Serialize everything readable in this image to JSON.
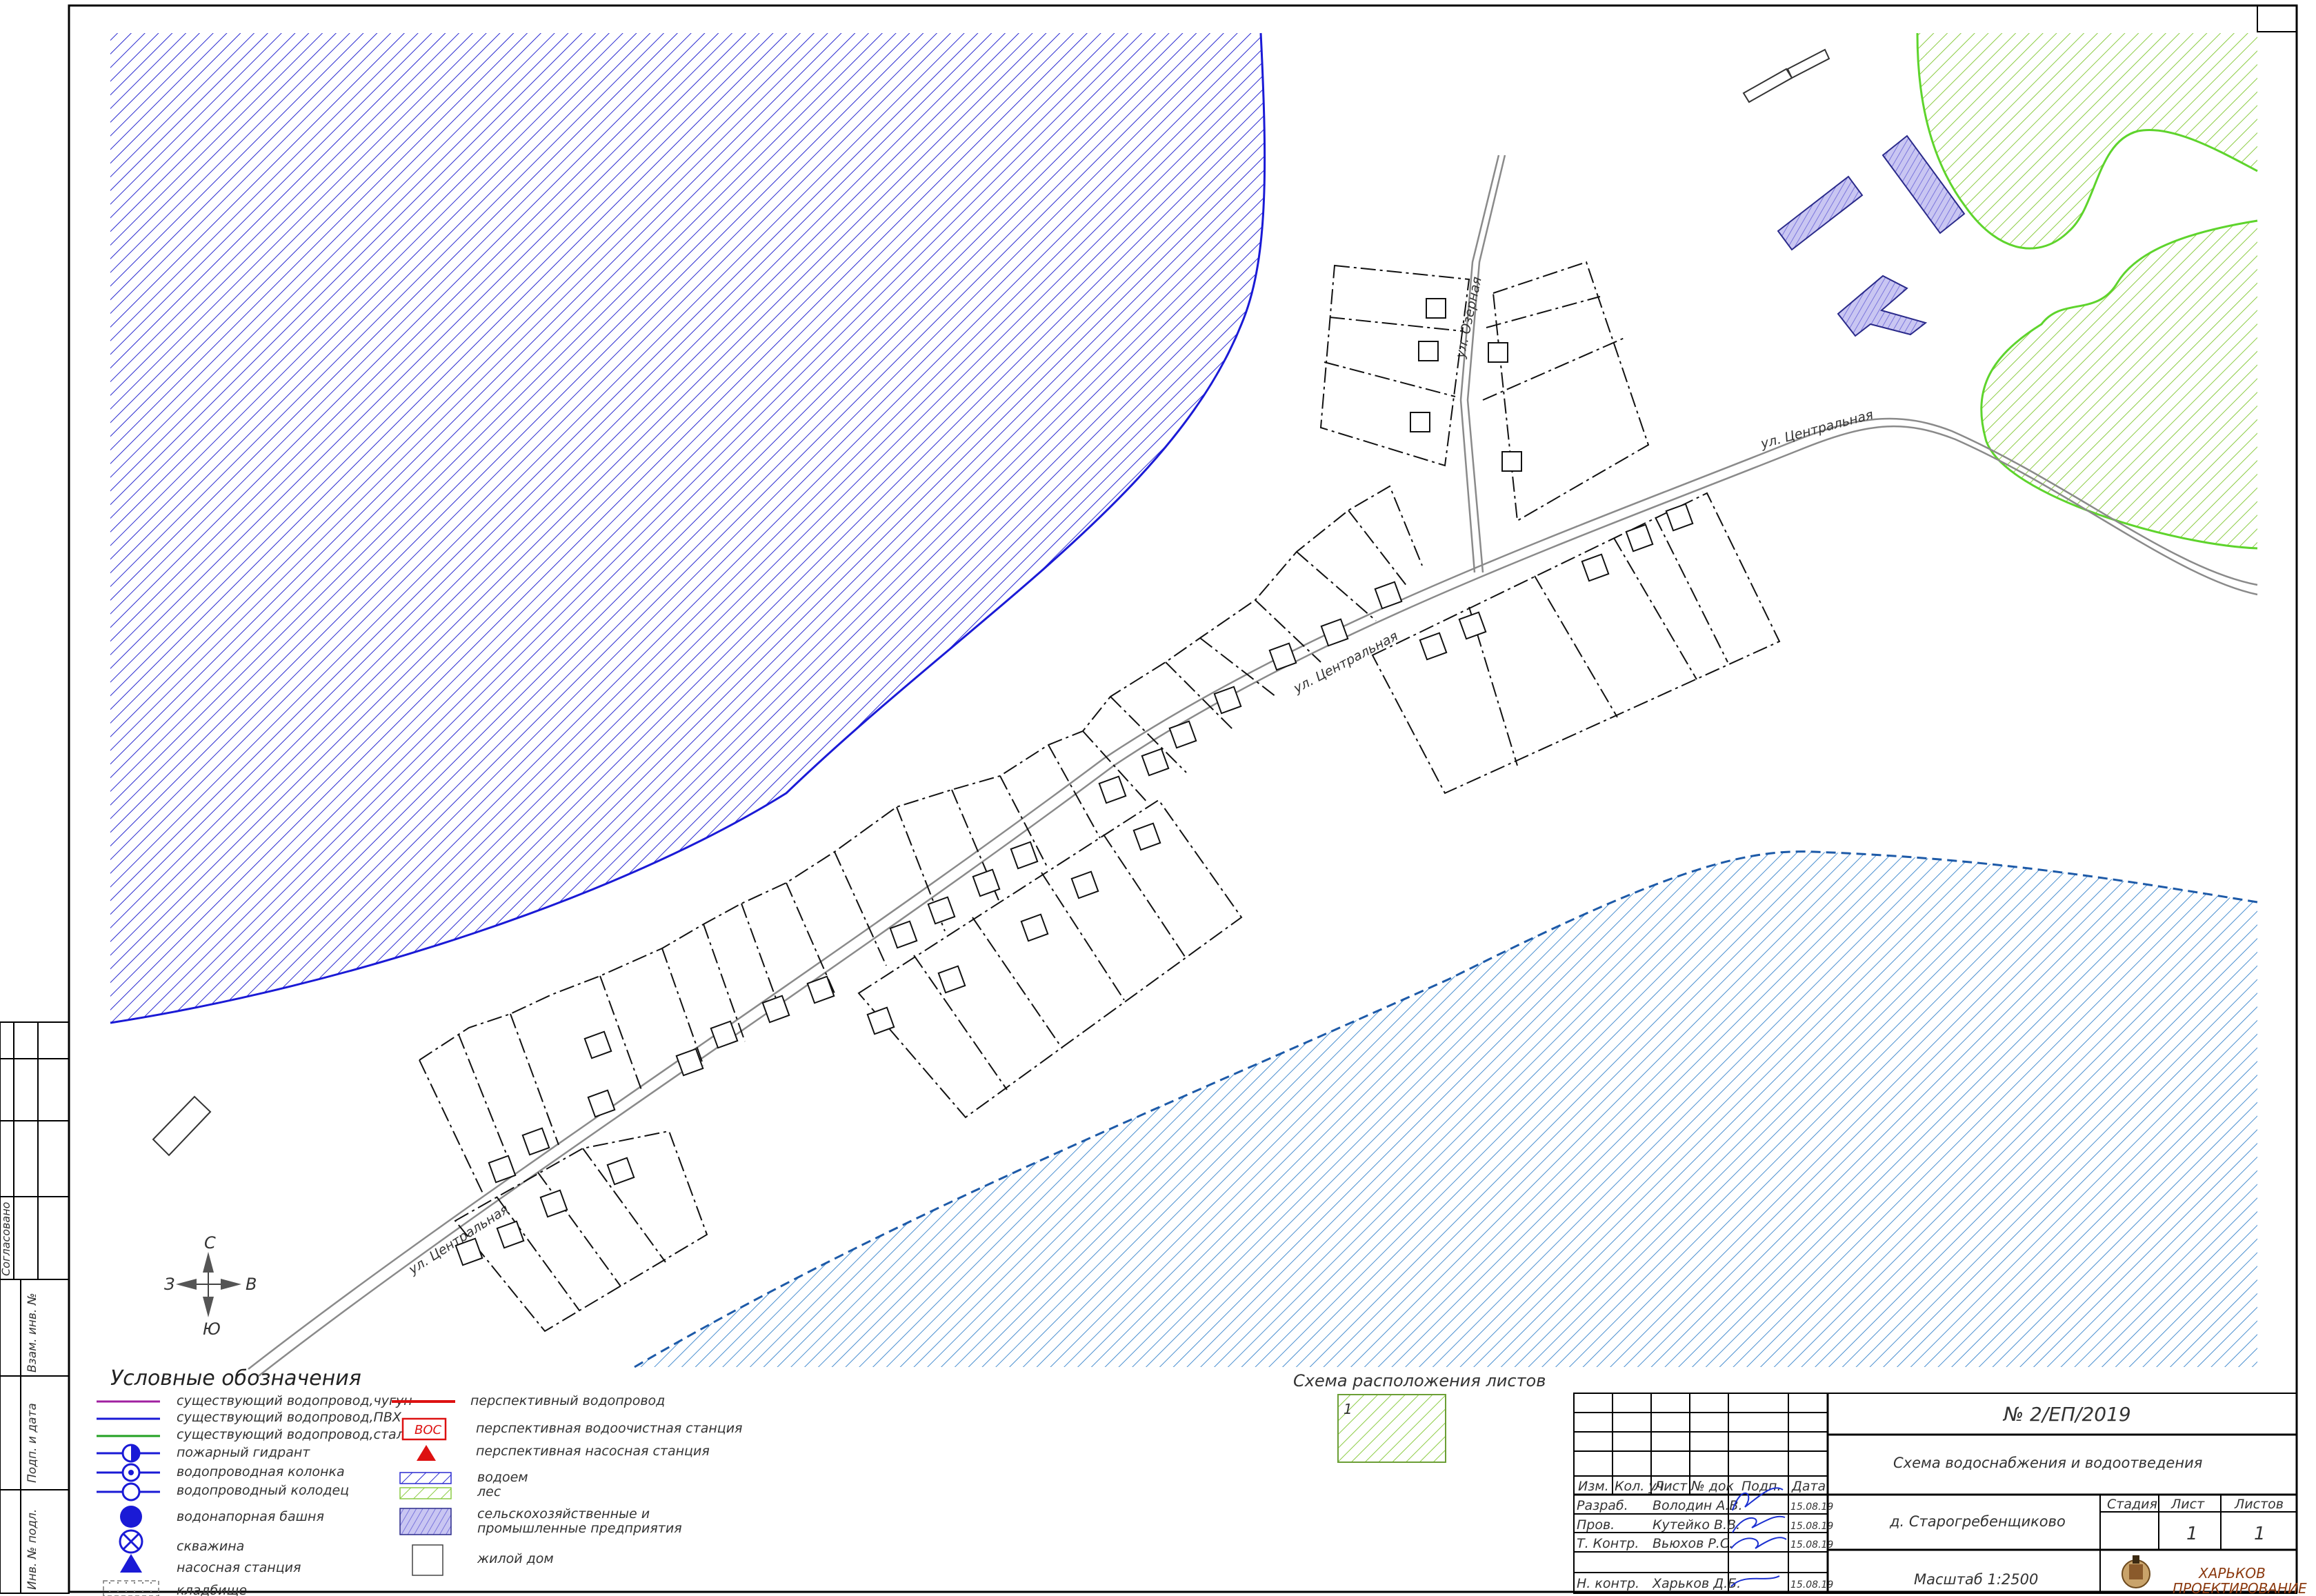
{
  "map": {
    "streets": {
      "central_1": "ул. Центральная",
      "central_2": "ул. Центральная",
      "central_3": "ул. Центральная",
      "lake": "ул. Озёрная"
    },
    "compass": {
      "north": "С",
      "south": "Ю",
      "west": "З",
      "east": "В"
    }
  },
  "legend": {
    "title": "Условные обозначения",
    "items": [
      "существующий водопровод,чугун",
      "существующий водопровод,ПВХ",
      "существующий водопровод,сталь",
      "пожарный гидрант",
      "водопроводная колонка",
      "водопроводный колодец",
      "водонапорная башня",
      "скважина",
      "насосная станция",
      "кладбище"
    ],
    "items_right": [
      "перспективный водопровод",
      "перспективная водоочистная станция",
      "перспективная насосная станция",
      "водоем",
      "лес",
      "сельскохозяйственные и",
      "промышленные предприятия",
      "жилой дом"
    ],
    "voc_label": "ВОС"
  },
  "sheet_scheme": {
    "title": "Схема расположения листов",
    "sheet_no": "1"
  },
  "title_block": {
    "doc_number": "№ 2/ЕП/2019",
    "project_title": "Схема водоснабжения и водоотведения",
    "location": "д. Старогребенщиково",
    "scale": "Масштаб 1:2500",
    "col_headers": [
      "Изм.",
      "Кол. уч",
      "Лист",
      "№ док",
      "Подп.",
      "Дата"
    ],
    "stage_headers": [
      "Стадия",
      "Лист",
      "Листов"
    ],
    "sheet": "1",
    "sheets": "1",
    "rows": [
      {
        "role": "Разраб.",
        "name": "Володин А.В.",
        "date": "15.08.19"
      },
      {
        "role": "Пров.",
        "name": "Кутейко В.В.",
        "date": "15.08.19"
      },
      {
        "role": "Т. Контр.",
        "name": "Вьюхов Р.С.",
        "date": "15.08.19"
      },
      {
        "role": "Н. контр.",
        "name": "Харьков Д.Б.",
        "date": "15.08.19"
      }
    ],
    "company_line1": "ХАРЬКОВ",
    "company_line2": "ПРОЕКТИРОВАНИЕ"
  },
  "side_stamp": [
    "Согласовано",
    "Взам. инв. №",
    "Подп. и дата",
    "Инв. № подл."
  ],
  "colors": {
    "water_pipe_blue": "#1a1ad6",
    "cast_iron_pipe": "#a020a0",
    "steel_pipe": "#22a022",
    "proposed_red": "#dd1111",
    "lake_hatch": "#2a2ad0",
    "river_hatch": "#4a8fd0",
    "forest_hatch": "#8ccc44",
    "industrial_fill": "#b3b0ec"
  }
}
